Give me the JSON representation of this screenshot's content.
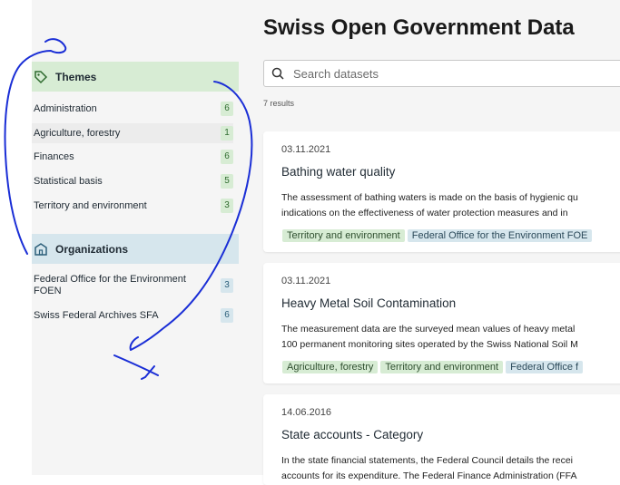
{
  "title": "Swiss Open Government Data",
  "search": {
    "placeholder": "Search datasets"
  },
  "results_label": "7 results",
  "themes": {
    "header": "Themes",
    "items": [
      {
        "label": "Administration",
        "count": "6"
      },
      {
        "label": "Agriculture, forestry",
        "count": "1"
      },
      {
        "label": "Finances",
        "count": "6"
      },
      {
        "label": "Statistical basis",
        "count": "5"
      },
      {
        "label": "Territory and environment",
        "count": "3"
      }
    ]
  },
  "organizations": {
    "header": "Organizations",
    "items": [
      {
        "label_line1": "Federal Office for the Environment",
        "label_line2": "FOEN",
        "count": "3"
      },
      {
        "label": "Swiss Federal Archives SFA",
        "count": "6"
      }
    ]
  },
  "datasets": [
    {
      "date": "03.11.2021",
      "title": "Bathing water quality",
      "desc1": "The assessment of bathing waters is made on the basis of hygienic qu",
      "desc2": "indications on the effectiveness of water protection measures and in",
      "tags": [
        "Territory and environment",
        "Federal Office for the Environment FOE"
      ]
    },
    {
      "date": "03.11.2021",
      "title": "Heavy Metal Soil Contamination",
      "desc1": "The measurement data are the surveyed mean values of heavy metal",
      "desc2": "100 permanent monitoring sites operated by the Swiss National Soil M",
      "tags": [
        "Agriculture, forestry",
        "Territory and environment",
        "Federal Office f"
      ]
    },
    {
      "date": "14.06.2016",
      "title": "State accounts - Category",
      "desc1": "In the state financial statements, the Federal Council details the recei",
      "desc2": "accounts for its expenditure. The Federal Finance Administration (FFA"
    }
  ],
  "colors": {
    "theme_green": "#d7ecd4",
    "org_blue": "#d6e6ed",
    "ink": "#1a2ed6"
  }
}
